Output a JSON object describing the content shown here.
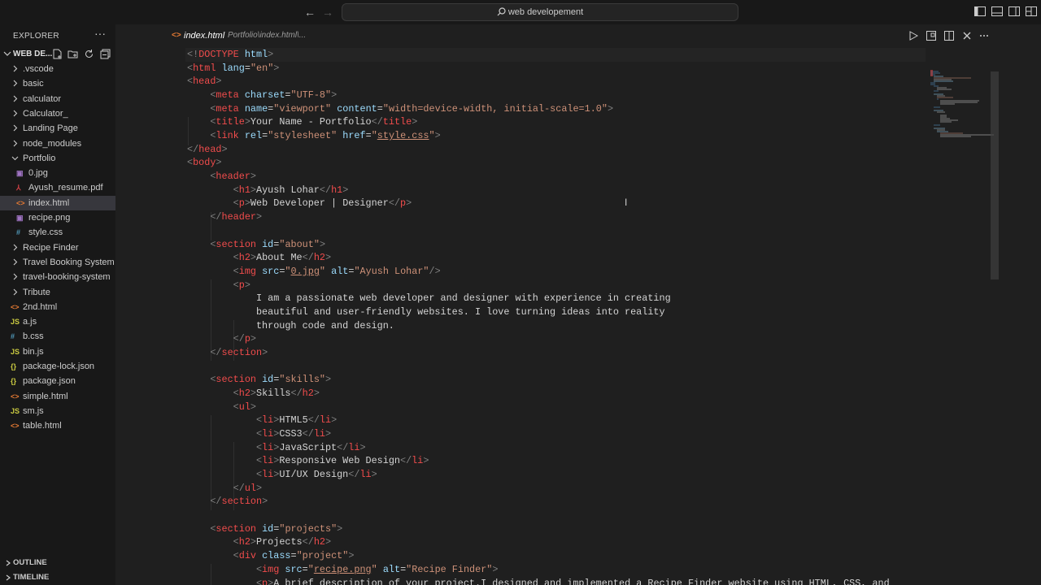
{
  "window": {
    "search_text": "web developement"
  },
  "sidebar": {
    "title": "EXPLORER",
    "more": "···",
    "workspace": "WEB DE...",
    "tree": [
      {
        "label": ".vscode",
        "type": "folder",
        "expanded": false
      },
      {
        "label": "basic",
        "type": "folder",
        "expanded": false
      },
      {
        "label": "calculator",
        "type": "folder",
        "expanded": false
      },
      {
        "label": "Calculator_",
        "type": "folder",
        "expanded": false
      },
      {
        "label": "Landing Page",
        "type": "folder",
        "expanded": false
      },
      {
        "label": "node_modules",
        "type": "folder",
        "expanded": false
      },
      {
        "label": "Portfolio",
        "type": "folder",
        "expanded": true
      },
      {
        "label": "0.jpg",
        "type": "image",
        "nested": true
      },
      {
        "label": "Ayush_resume.pdf",
        "type": "pdf",
        "nested": true
      },
      {
        "label": "index.html",
        "type": "html",
        "nested": true,
        "selected": true
      },
      {
        "label": "recipe.png",
        "type": "image",
        "nested": true
      },
      {
        "label": "style.css",
        "type": "css",
        "nested": true
      },
      {
        "label": "Recipe Finder",
        "type": "folder",
        "expanded": false
      },
      {
        "label": "Travel Booking System",
        "type": "folder",
        "expanded": false
      },
      {
        "label": "travel-booking-system",
        "type": "folder",
        "expanded": false
      },
      {
        "label": "Tribute",
        "type": "folder",
        "expanded": false
      },
      {
        "label": "2nd.html",
        "type": "html"
      },
      {
        "label": "a.js",
        "type": "js"
      },
      {
        "label": "b.css",
        "type": "css"
      },
      {
        "label": "bin.js",
        "type": "js"
      },
      {
        "label": "package-lock.json",
        "type": "json"
      },
      {
        "label": "package.json",
        "type": "json"
      },
      {
        "label": "simple.html",
        "type": "html"
      },
      {
        "label": "sm.js",
        "type": "js"
      },
      {
        "label": "table.html",
        "type": "html"
      }
    ],
    "outline_label": "OUTLINE",
    "timeline_label": "TIMELINE"
  },
  "editor": {
    "tab_name": "index.html",
    "tab_path": "Portfolio\\index.html\\...",
    "lines": [
      "<!DOCTYPE html>",
      "<html lang=\"en\">",
      "<head>",
      "    <meta charset=\"UTF-8\">",
      "    <meta name=\"viewport\" content=\"width=device-width, initial-scale=1.0\">",
      "    <title>Your Name - Portfolio</title>",
      "    <link rel=\"stylesheet\" href=\"style.css\">",
      "</head>",
      "<body>",
      "    <header>",
      "        <h1>Ayush Lohar</h1>",
      "        <p>Web Developer | Designer</p>",
      "    </header>",
      "",
      "    <section id=\"about\">",
      "        <h2>About Me</h2>",
      "        <img src=\"0.jpg\" alt=\"Ayush Lohar\"/>",
      "        <p>",
      "            I am a passionate web developer and designer with experience in creating",
      "            beautiful and user-friendly websites. I love turning ideas into reality",
      "            through code and design.",
      "        </p>",
      "    </section>",
      "",
      "    <section id=\"skills\">",
      "        <h2>Skills</h2>",
      "        <ul>",
      "            <li>HTML5</li>",
      "            <li>CSS3</li>",
      "            <li>JavaScript</li>",
      "            <li>Responsive Web Design</li>",
      "            <li>UI/UX Design</li>",
      "        </ul>",
      "    </section>",
      "",
      "    <section id=\"projects\">",
      "        <h2>Projects</h2>",
      "        <div class=\"project\">",
      "            <img src=\"recipe.png\" alt=\"Recipe Finder\">",
      "            <p>A brief description of your project.I designed and implemented a Recipe Finder website using HTML, CSS, and"
    ]
  },
  "colors": {
    "bg": "#181818",
    "editor_bg": "#1f1f1f",
    "tag": "#569cd6",
    "attr": "#9cdcfe",
    "string": "#ce9178"
  }
}
